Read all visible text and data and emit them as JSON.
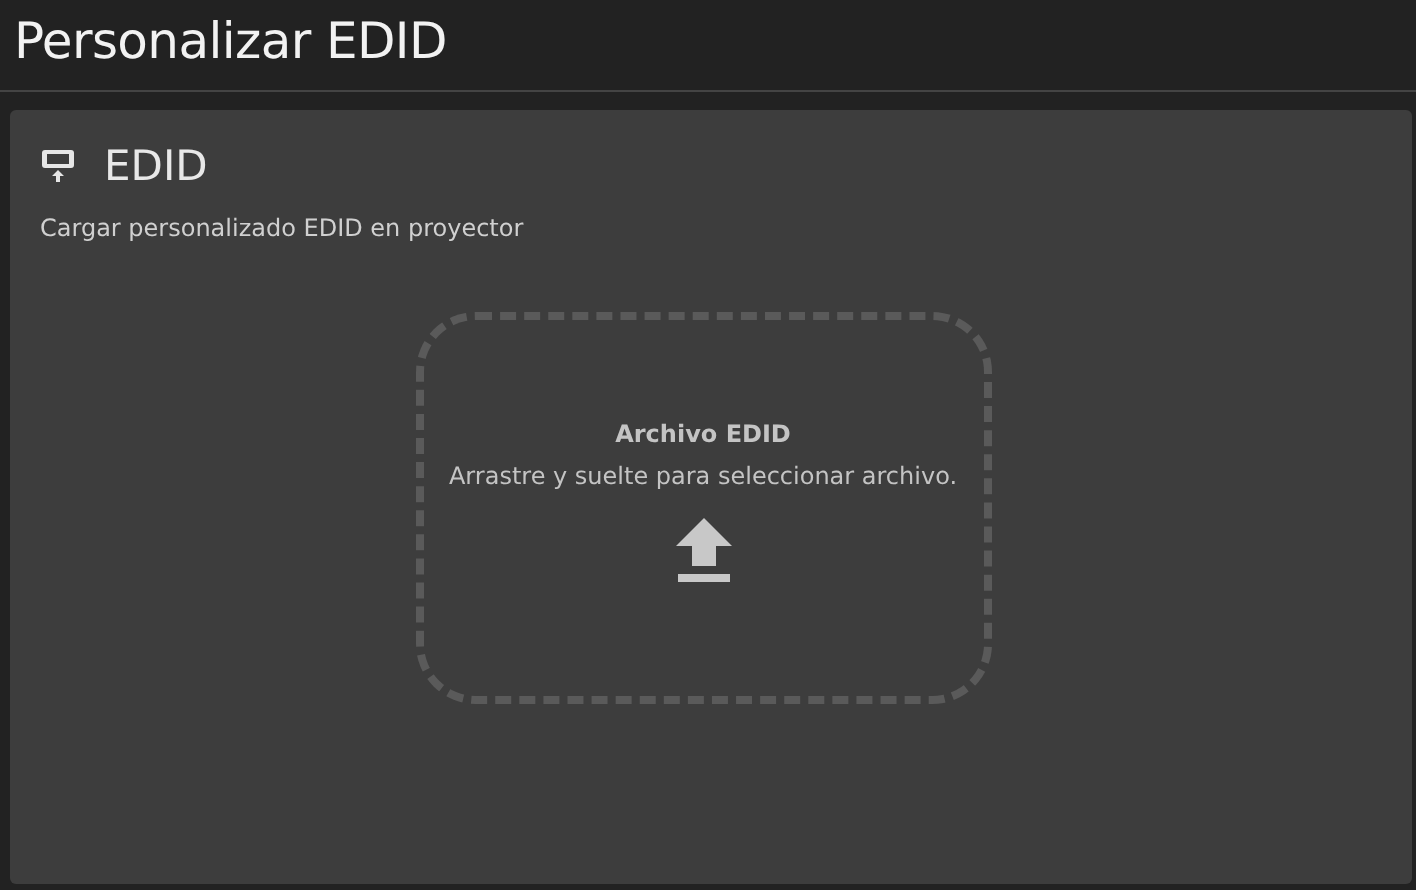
{
  "page": {
    "title": "Personalizar EDID"
  },
  "card": {
    "title": "EDID",
    "description": "Cargar personalizado EDID en proyector"
  },
  "dropzone": {
    "label": "Archivo EDID",
    "hint": "Arrastre y suelte para seleccionar archivo."
  }
}
